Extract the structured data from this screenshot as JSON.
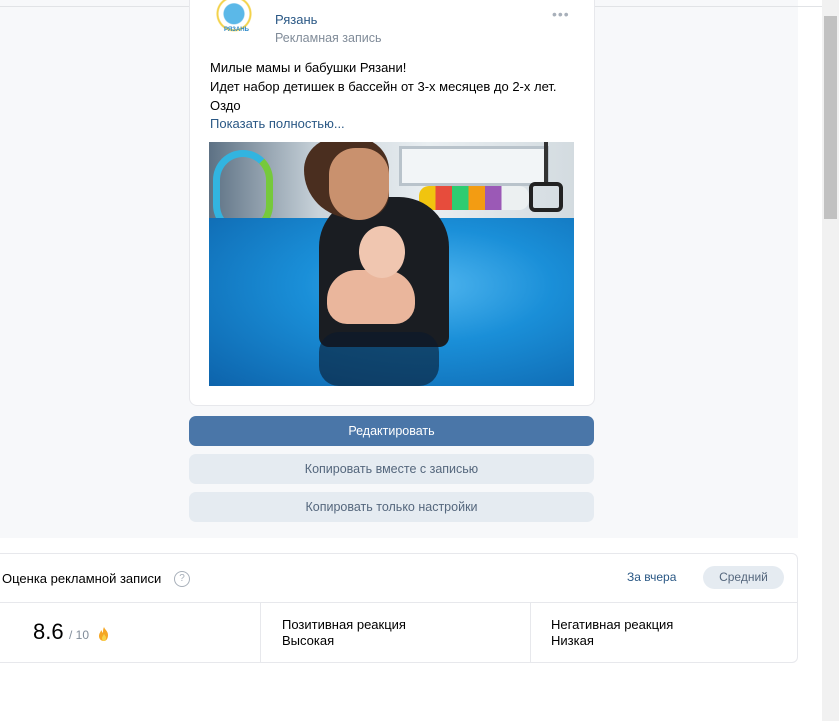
{
  "post": {
    "group_name": "Рязань",
    "ad_label": "Рекламная запись",
    "logo_text": "РЯЗАНЬ",
    "more_icon": "more-horizontal-icon",
    "text_lines": [
      "Милые мамы и бабушки Рязани!",
      "Идет набор детишек в бассейн от 3-х месяцев до 2-х лет.",
      "Оздо"
    ],
    "show_more": "Показать полностью..."
  },
  "actions": {
    "edit": "Редактировать",
    "copy_with_post": "Копировать вместе с записью",
    "copy_settings": "Копировать только настройки"
  },
  "rating": {
    "title": "Оценка рекламной записи",
    "help": "?",
    "period": "За вчера",
    "level_badge": "Средний",
    "score": "8.6",
    "score_max": "/ 10",
    "positive_label": "Позитивная реакция",
    "positive_value": "Высокая",
    "negative_label": "Негативная реакция",
    "negative_value": "Низкая"
  },
  "colors": {
    "link": "#2a5885",
    "primary_button": "#4a76a8",
    "secondary_button": "#e5ebf1",
    "muted_text": "#818c99"
  }
}
